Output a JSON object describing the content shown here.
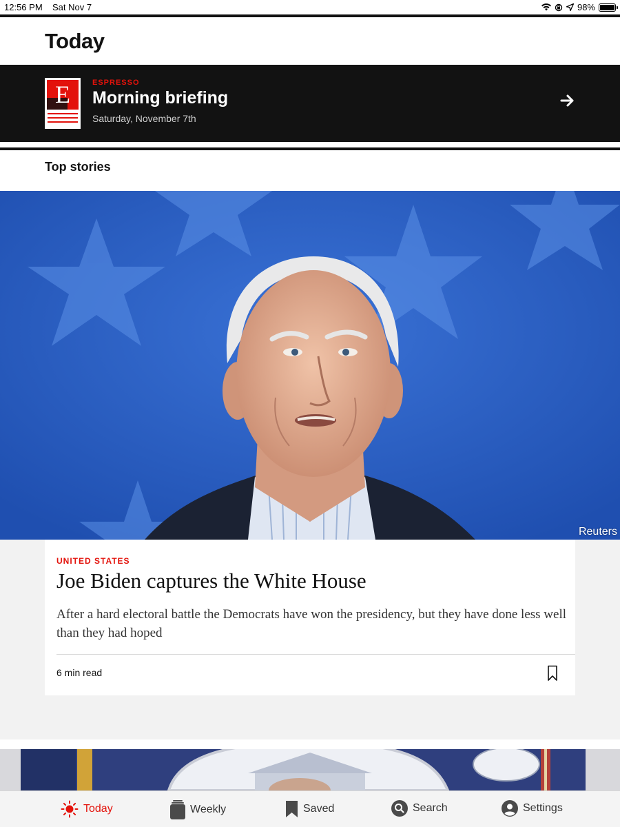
{
  "status_bar": {
    "time": "12:56 PM",
    "date": "Sat Nov 7",
    "battery": "98%",
    "battery_level": 0.98,
    "icons": [
      "wifi-icon",
      "orientation-lock-icon",
      "location-icon",
      "battery-icon"
    ]
  },
  "header": {
    "title": "Today"
  },
  "espresso": {
    "kicker": "ESPRESSO",
    "title": "Morning briefing",
    "date": "Saturday, November 7th",
    "logo_letter": "E",
    "icon": "arrow-right-icon"
  },
  "section": {
    "title": "Top stories"
  },
  "top_story": {
    "image_credit": "Reuters",
    "kicker": "UNITED STATES",
    "headline": "Joe Biden captures the White House",
    "standfirst": "After a hard electoral battle the Democrats have won the presidency, but they have done less well than they had hoped",
    "read_time": "6 min read",
    "bookmark_icon": "bookmark-icon"
  },
  "tabs": [
    {
      "label": "Today",
      "icon": "sun-icon",
      "active": true
    },
    {
      "label": "Weekly",
      "icon": "magazine-stack-icon",
      "active": false
    },
    {
      "label": "Saved",
      "icon": "bookmark-icon",
      "active": false
    },
    {
      "label": "Search",
      "icon": "search-icon",
      "active": false
    },
    {
      "label": "Settings",
      "icon": "user-icon",
      "active": false
    }
  ],
  "colors": {
    "accent": "#e3120b",
    "banner": "#121212",
    "hero_background": "#2a5fc2"
  }
}
